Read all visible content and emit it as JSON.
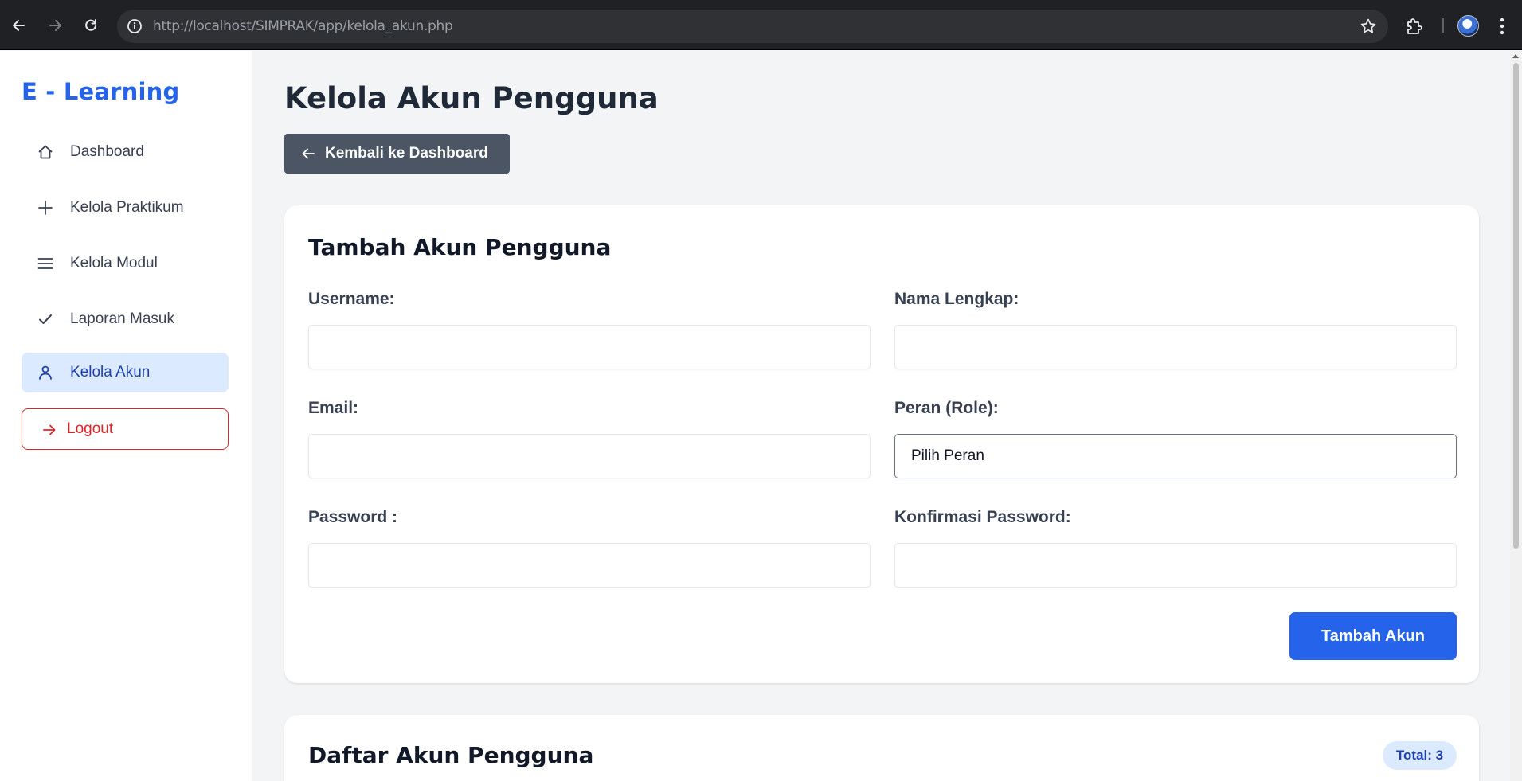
{
  "browser": {
    "url": "http://localhost/SIMPRAK/app/kelola_akun.php"
  },
  "sidebar": {
    "brand": "E - Learning",
    "items": [
      {
        "label": "Dashboard",
        "icon": "home-icon"
      },
      {
        "label": "Kelola Praktikum",
        "icon": "plus-icon"
      },
      {
        "label": "Kelola Modul",
        "icon": "menu-icon"
      },
      {
        "label": "Laporan Masuk",
        "icon": "check-icon"
      },
      {
        "label": "Kelola Akun",
        "icon": "user-icon",
        "active": true
      }
    ],
    "logout_label": "Logout"
  },
  "main": {
    "title": "Kelola Akun Pengguna",
    "back_label": "Kembali ke Dashboard",
    "form": {
      "title": "Tambah Akun Pengguna",
      "username_label": "Username:",
      "fullname_label": "Nama Lengkap:",
      "email_label": "Email:",
      "role_label": "Peran (Role):",
      "role_selected": "Pilih Peran",
      "password_label": "Password :",
      "confirm_label": "Konfirmasi Password:",
      "submit_label": "Tambah Akun"
    },
    "list": {
      "title": "Daftar Akun Pengguna",
      "total_badge": "Total: 3"
    }
  },
  "colors": {
    "accent": "#2563eb",
    "active_bg": "#dbeafe",
    "danger": "#dc2626",
    "back_button": "#4b5563"
  }
}
